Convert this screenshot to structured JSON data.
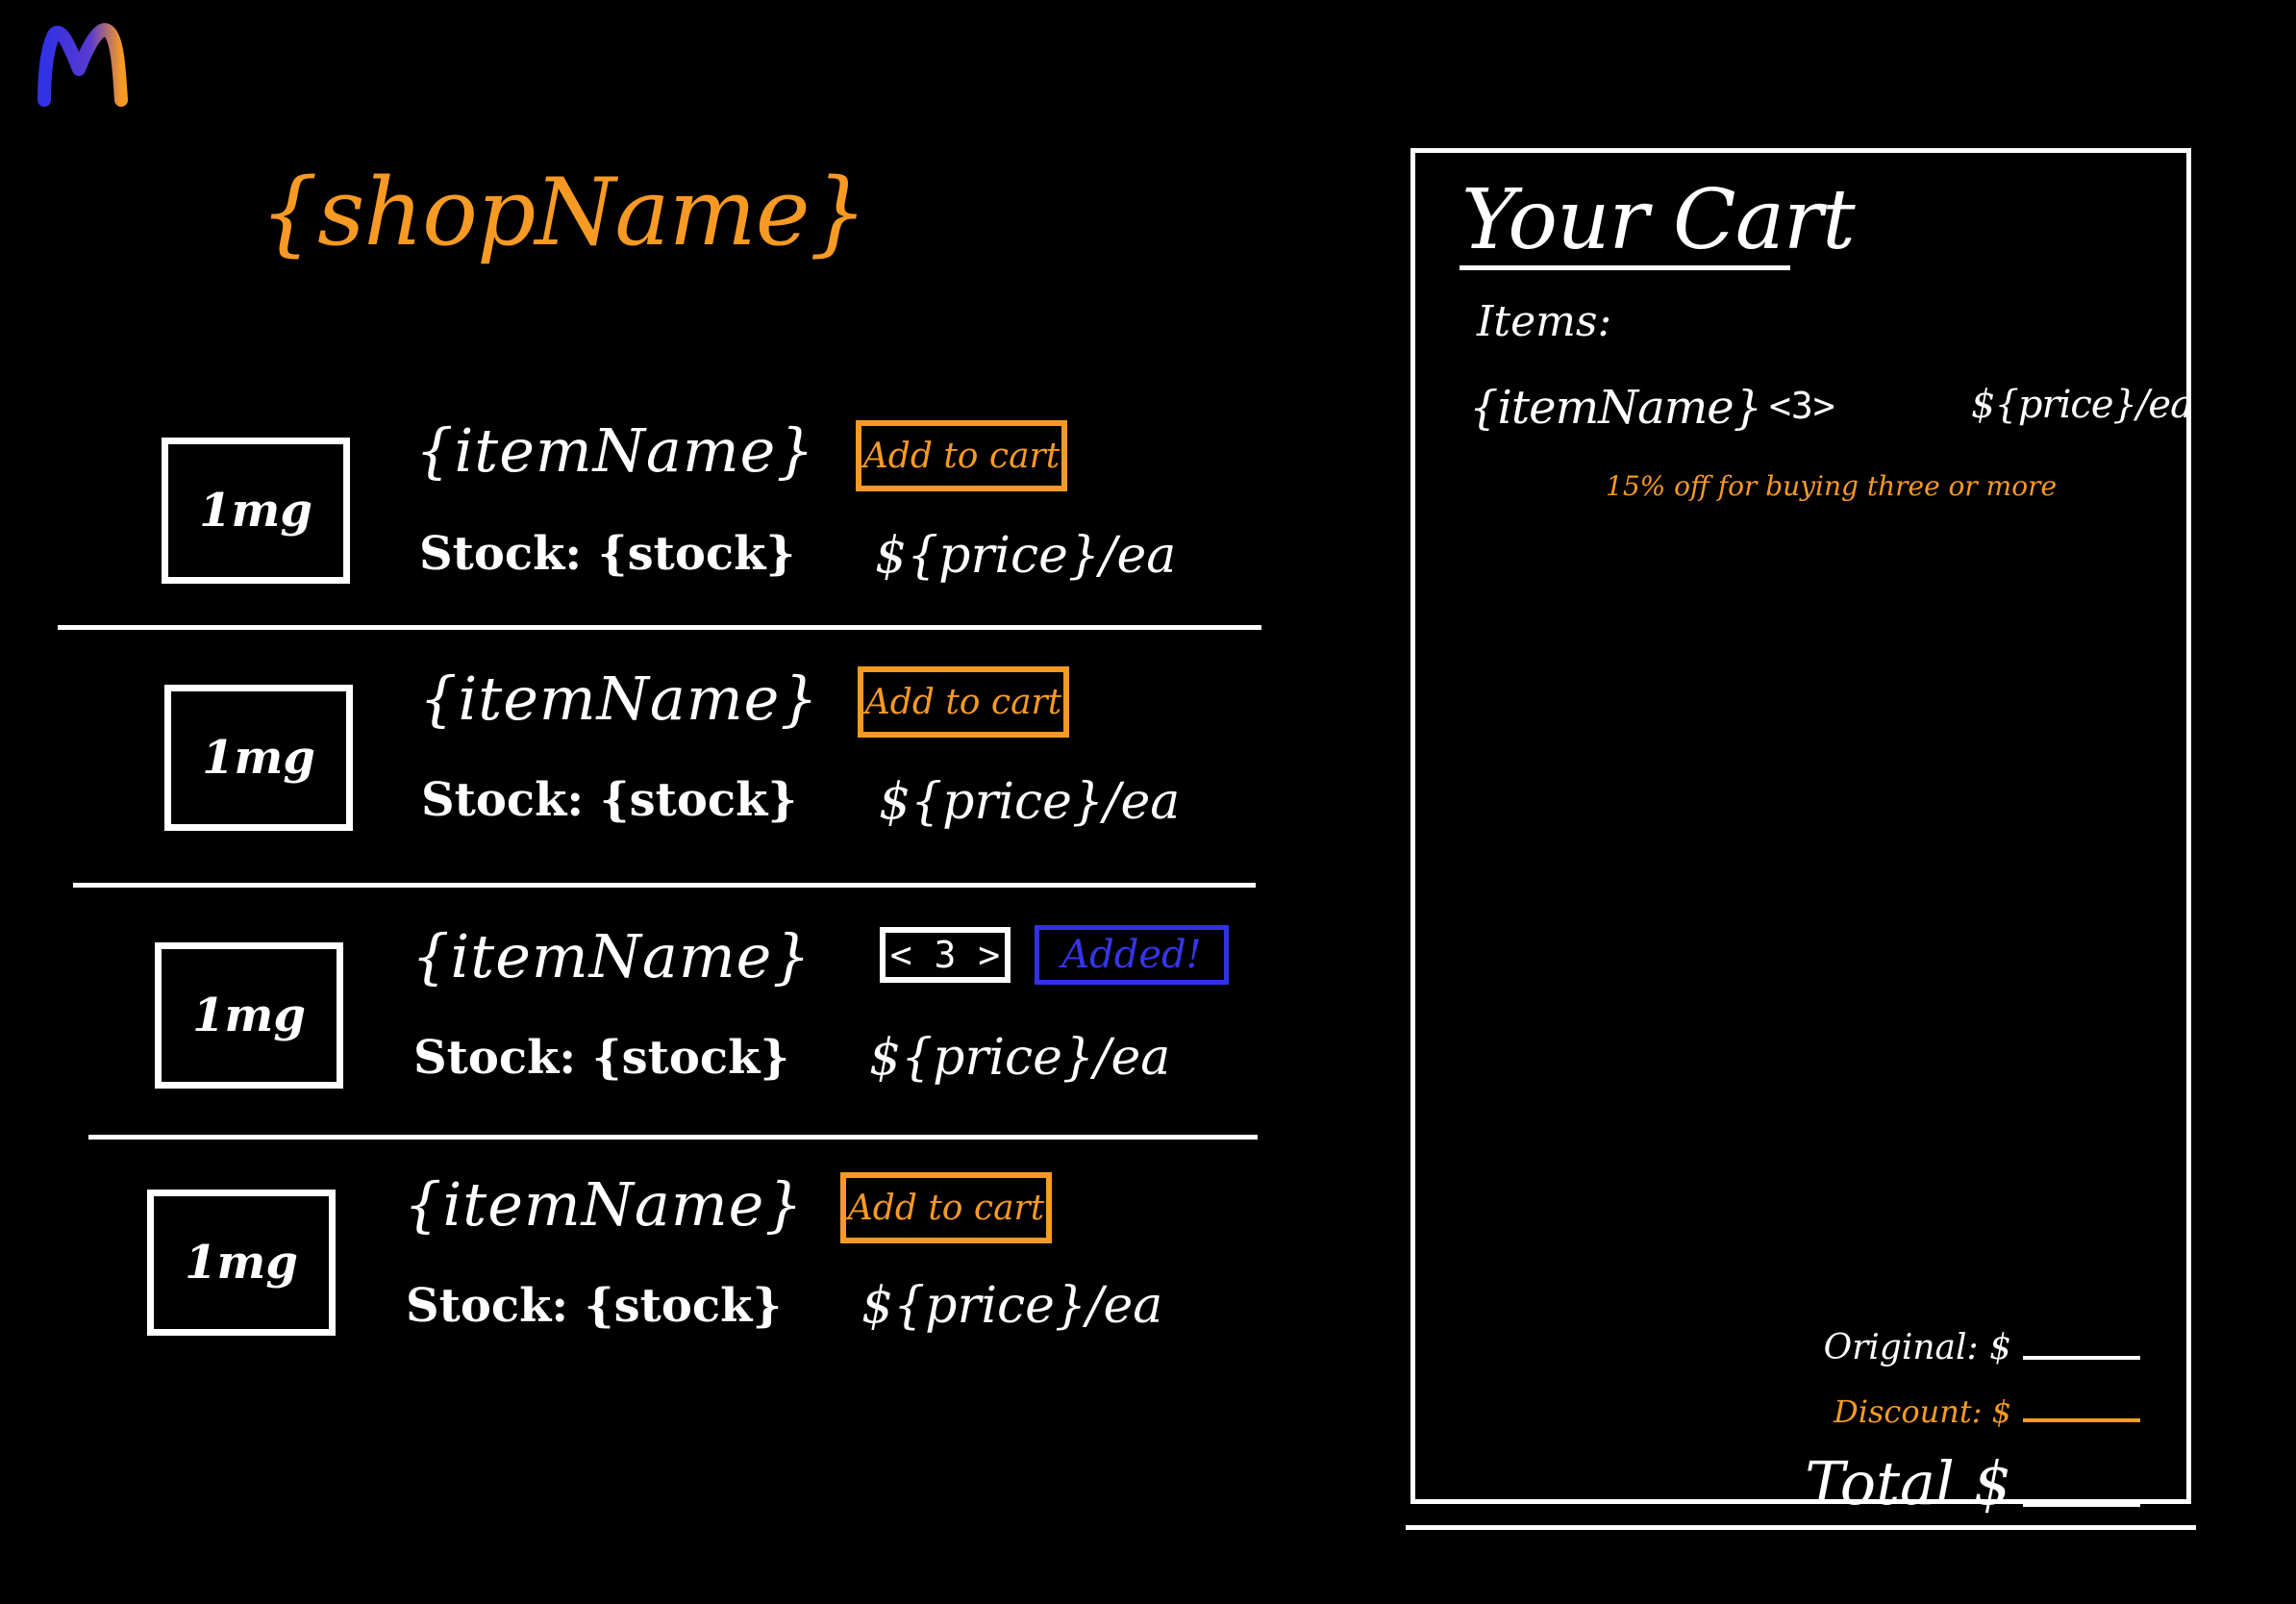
{
  "logo": {
    "letter": "M",
    "colors": [
      "#3131e6",
      "#f79a24"
    ]
  },
  "shop": {
    "title": "{shopName}"
  },
  "items": [
    {
      "thumb": "1mg",
      "name": "{itemName}",
      "stock": "Stock: {stock}",
      "price": "${price}/ea",
      "action": "Add to cart"
    },
    {
      "thumb": "1mg",
      "name": "{itemName}",
      "stock": "Stock: {stock}",
      "price": "${price}/ea",
      "action": "Add to cart"
    },
    {
      "thumb": "1mg",
      "name": "{itemName}",
      "stock": "Stock: {stock}",
      "price": "${price}/ea",
      "qty": "< 3 >",
      "added": "Added!"
    },
    {
      "thumb": "1mg",
      "name": "{itemName}",
      "stock": "Stock: {stock}",
      "price": "${price}/ea",
      "action": "Add to cart"
    }
  ],
  "cart": {
    "title": "Your Cart",
    "items_label": "Items:",
    "lines": [
      {
        "name": "{itemName}",
        "qty": "<3>",
        "price": "${price}/ea",
        "note": "15% off for buying three or more"
      }
    ],
    "summary": {
      "original": "Original: $",
      "discount": "Discount: $",
      "total": "Total $"
    }
  },
  "colors": {
    "accent": "#f79a24",
    "added": "#3131e6",
    "background": "#000000",
    "ink": "#ffffff"
  }
}
